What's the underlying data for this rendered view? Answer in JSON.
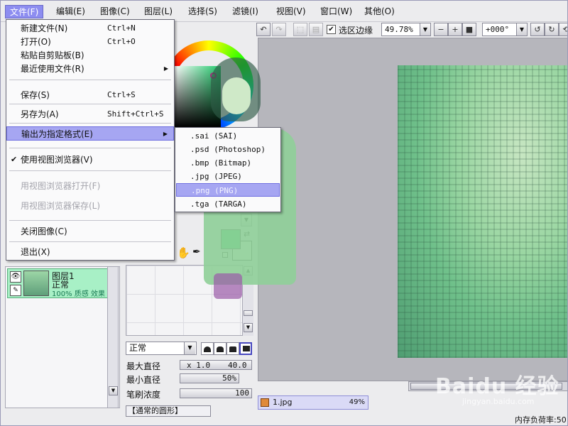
{
  "menubar": {
    "items": [
      {
        "label": "文件(F)"
      },
      {
        "label": "编辑(E)"
      },
      {
        "label": "图像(C)"
      },
      {
        "label": "图层(L)"
      },
      {
        "label": "选择(S)"
      },
      {
        "label": "滤镜(I)"
      },
      {
        "label": "视图(V)"
      },
      {
        "label": "窗口(W)"
      },
      {
        "label": "其他(O)"
      }
    ]
  },
  "file_menu": {
    "new": {
      "label": "新建文件(N)",
      "shortcut": "Ctrl+N"
    },
    "open": {
      "label": "打开(O)",
      "shortcut": "Ctrl+O"
    },
    "paste": {
      "label": "粘贴自剪贴板(B)"
    },
    "recent": {
      "label": "最近使用文件(R)"
    },
    "save": {
      "label": "保存(S)",
      "shortcut": "Ctrl+S"
    },
    "save_as": {
      "label": "另存为(A)",
      "shortcut": "Shift+Ctrl+S"
    },
    "export": {
      "label": "输出为指定格式(E)"
    },
    "use_browser": {
      "label": "使用视图浏览器(V)"
    },
    "browser_open": {
      "label": "用视图浏览器打开(F)"
    },
    "browser_save": {
      "label": "用视图浏览器保存(L)"
    },
    "close": {
      "label": "关闭图像(C)"
    },
    "exit": {
      "label": "退出(X)"
    }
  },
  "export_submenu": [
    ".sai (SAI)",
    ".psd (Photoshop)",
    ".bmp (Bitmap)",
    ".jpg (JPEG)",
    ".png (PNG)",
    ".tga (TARGA)"
  ],
  "toolbar": {
    "selection_edge_label": "选区边缘",
    "selection_edge_checked": "✔",
    "zoom": "49.78%",
    "rotation": "+000°"
  },
  "color": {
    "foreground": "#1fd06a",
    "background": "#ffffff"
  },
  "layer": {
    "name": "图层1",
    "mode": "正常",
    "info": "100% 质感 效果"
  },
  "brush": {
    "mode": "正常",
    "max_size_label": "最大直径",
    "max_size_mult": "x 1.0",
    "max_size_value": "40.0",
    "min_size_label": "最小直径",
    "min_size_value": "50%",
    "density_label": "笔刷浓度",
    "density_value": "100",
    "texture": "【通常的圆形】"
  },
  "document": {
    "name": "1.jpg",
    "zoom": "49%"
  },
  "status": {
    "memory": "内存负荷率:50"
  },
  "watermark": {
    "main": "Baidu 经验",
    "sub": "jingyan.baidu.com"
  }
}
